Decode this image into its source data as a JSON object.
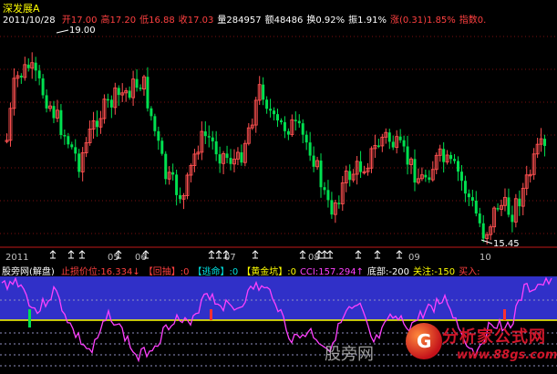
{
  "header": {
    "title": "深发展A",
    "date": "2011/10/28",
    "fields": [
      {
        "label": "开",
        "value": "17.00",
        "color": "#ff4040"
      },
      {
        "label": "高",
        "value": "17.20",
        "color": "#ff4040"
      },
      {
        "label": "低",
        "value": "16.88",
        "color": "#ff4040"
      },
      {
        "label": "收",
        "value": "17.03",
        "color": "#ff4040"
      },
      {
        "label": "量",
        "value": "284957",
        "color": "#ffffff"
      },
      {
        "label": "额",
        "value": "48486",
        "color": "#ffffff"
      },
      {
        "label": "换",
        "value": "0.92%",
        "color": "#ffffff"
      },
      {
        "label": "振",
        "value": "1.91%",
        "color": "#ffffff"
      },
      {
        "label": "涨",
        "value": "(0.31)1.85%",
        "color": "#ff4040"
      },
      {
        "label": "指数",
        "value": "0.",
        "color": "#ff4040"
      }
    ]
  },
  "price_chart": {
    "high_marker": "19.00",
    "low_marker": "15.45",
    "colors": {
      "up": "#ff5050",
      "down": "#00e050",
      "grid": "#7a1010"
    }
  },
  "date_axis": {
    "labels": [
      "2011",
      "05",
      "06",
      "07",
      "08",
      "09",
      "10"
    ],
    "color": "#c0c0c0",
    "arrow_color": "#ffffff"
  },
  "indicator": {
    "name": "股旁网(解盘)",
    "items": [
      {
        "label": "止损价位:",
        "value": "16.334",
        "suffix": "↓",
        "color": "#ff4040"
      },
      {
        "label": "【回抽】",
        "value": ":0",
        "color": "#ff4040"
      },
      {
        "label": "【逃命】",
        "value": ":0",
        "color": "#00e0e0"
      },
      {
        "label": "【黄金坑】",
        "value": ":0",
        "color": "#ffff00"
      },
      {
        "label": "CCI:",
        "value": "157.294",
        "suffix": "↑",
        "color": "#ff40ff"
      },
      {
        "label": "底部:",
        "value": "-200",
        "color": "#ffffff"
      },
      {
        "label": "关注:",
        "value": "-150",
        "color": "#ffff00"
      },
      {
        "label": "买入:",
        "value": "",
        "color": "#ff4040"
      }
    ],
    "background": "#3030c8",
    "line_color": "#ff40ff"
  },
  "watermark": "股旁网",
  "brand": {
    "name": "分析家公式网",
    "url": "www.88gs.com"
  }
}
